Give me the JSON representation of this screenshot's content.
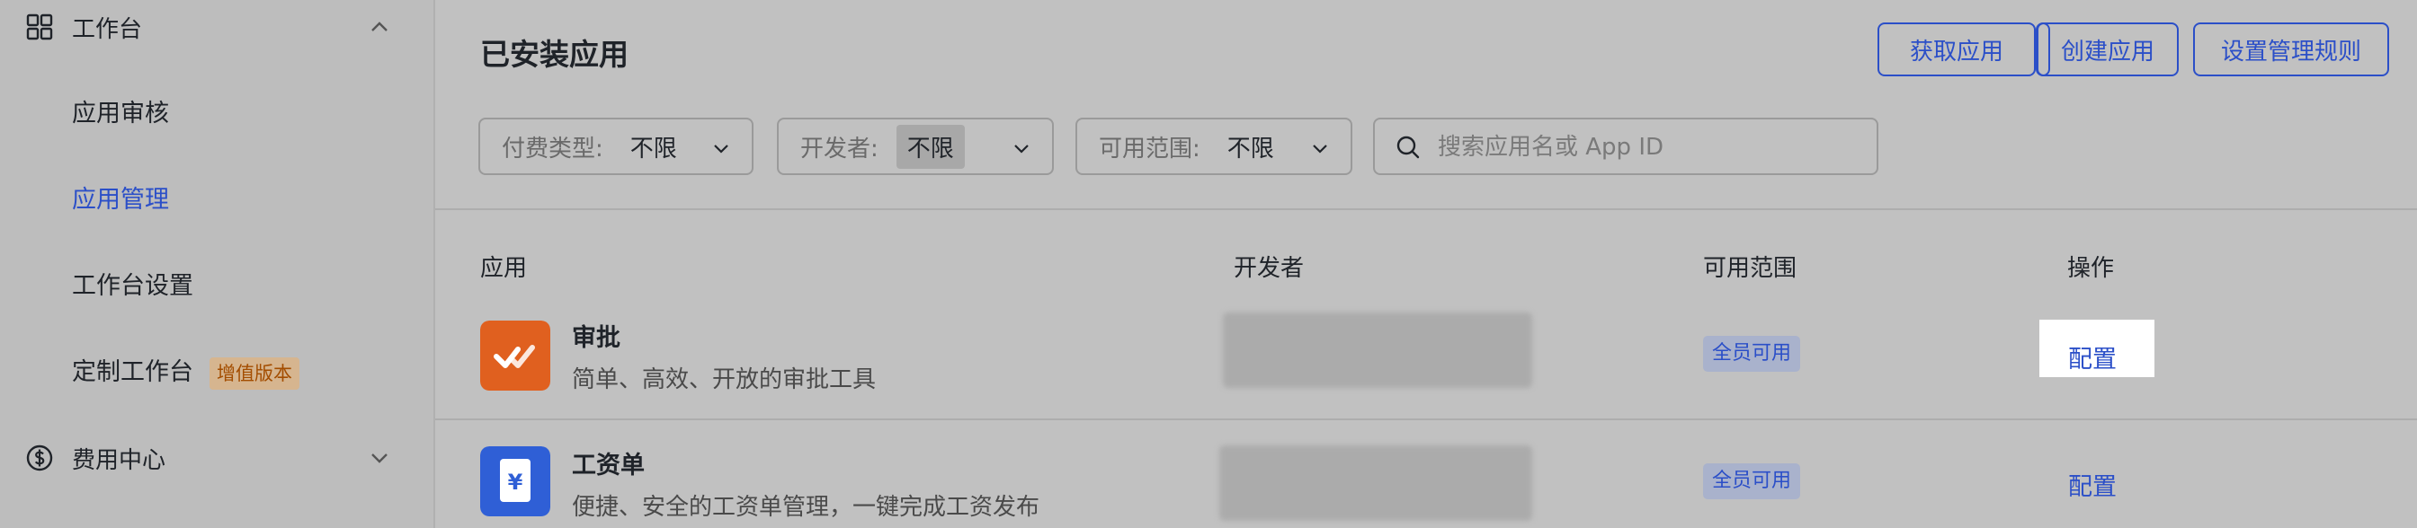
{
  "sidebar": {
    "workbench_group": {
      "label": "工作台",
      "icon": "grid-icon",
      "expanded": true
    },
    "items": [
      {
        "label": "应用审核",
        "active": false
      },
      {
        "label": "应用管理",
        "active": true
      },
      {
        "label": "工作台设置",
        "active": false
      },
      {
        "label": "定制工作台",
        "active": false,
        "badge": "增值版本"
      }
    ],
    "billing_group": {
      "label": "费用中心",
      "icon": "dollar-circle-icon",
      "expanded": false
    }
  },
  "header": {
    "title": "已安装应用",
    "buttons": {
      "get_app": "获取应用",
      "create_app": "创建应用",
      "admin_rules": "设置管理规则"
    }
  },
  "filters": {
    "payment_type": {
      "label": "付费类型:",
      "value": "不限"
    },
    "developer": {
      "label": "开发者:",
      "value": "不限"
    },
    "availability": {
      "label": "可用范围:",
      "value": "不限"
    },
    "search": {
      "placeholder": "搜索应用名或 App ID",
      "value": ""
    }
  },
  "table": {
    "columns": {
      "app": "应用",
      "developer": "开发者",
      "scope": "可用范围",
      "actions": "操作"
    },
    "rows": [
      {
        "name": "审批",
        "description": "简单、高效、开放的审批工具",
        "icon": "approval-check-icon",
        "icon_color": "#e0601f",
        "scope": "全员可用",
        "action": "配置"
      },
      {
        "name": "工资单",
        "description": "便捷、安全的工资单管理，一键完成工资发布",
        "icon": "yuan-icon",
        "icon_color": "#2f5fd6",
        "scope": "全员可用",
        "action": "配置"
      }
    ]
  },
  "colors": {
    "accent": "#2b4fc8",
    "badge_text": "#a34d00"
  }
}
